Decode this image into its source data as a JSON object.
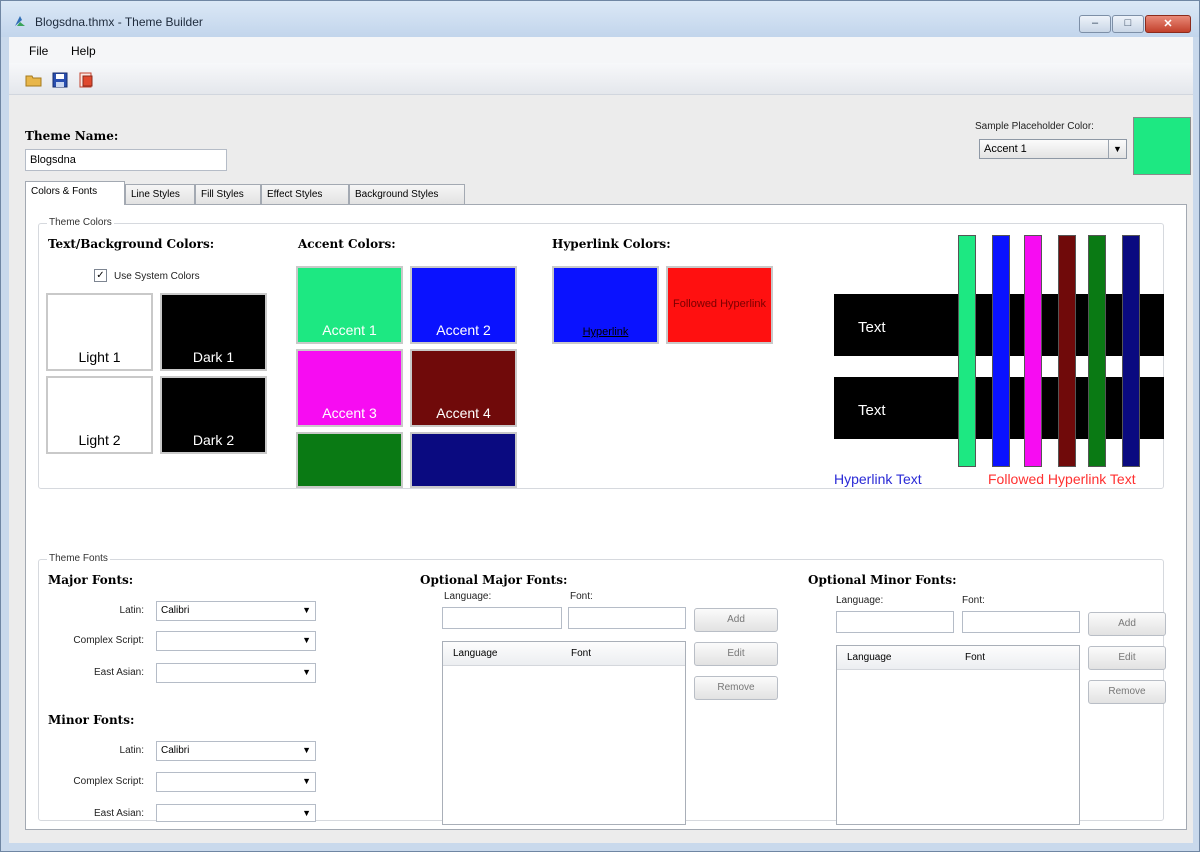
{
  "window": {
    "title": "Blogsdna.thmx - Theme Builder",
    "min": "–",
    "max": "□",
    "close": "✕"
  },
  "menu": [
    "File",
    "Help"
  ],
  "toolbar": {
    "icons": [
      "open-folder-icon",
      "save-icon",
      "export-icon"
    ]
  },
  "theme_name": {
    "label": "Theme Name:",
    "value": "Blogsdna"
  },
  "placeholder": {
    "label": "Sample Placeholder Color:",
    "selected": "Accent 1",
    "color": "#1de882"
  },
  "tabs": [
    "Colors & Fonts",
    "Line Styles",
    "Fill Styles",
    "Effect Styles",
    "Background Styles"
  ],
  "theme_colors": {
    "legend": "Theme Colors",
    "text_bg": {
      "heading": "Text/Background Colors:",
      "use_system": "Use System Colors",
      "swatches": [
        {
          "label": "Light 1",
          "color": "#ffffff",
          "text": "#000000"
        },
        {
          "label": "Dark 1",
          "color": "#000000",
          "text": "#ffffff"
        },
        {
          "label": "Light 2",
          "color": "#ffffff",
          "text": "#000000"
        },
        {
          "label": "Dark 2",
          "color": "#000000",
          "text": "#ffffff"
        }
      ]
    },
    "accent": {
      "heading": "Accent Colors:",
      "swatches": [
        {
          "label": "Accent 1",
          "color": "#1de882"
        },
        {
          "label": "Accent 2",
          "color": "#0a12ff"
        },
        {
          "label": "Accent 3",
          "color": "#f70cf2"
        },
        {
          "label": "Accent 4",
          "color": "#700a0a"
        },
        {
          "label": "",
          "color": "#0a7a14"
        },
        {
          "label": "",
          "color": "#0a0a80"
        }
      ]
    },
    "hyperlink": {
      "heading": "Hyperlink Colors:",
      "hyperlink_label": "Hyperlink",
      "hyperlink_color": "#0a12ff",
      "followed_label": "Followed Hyperlink",
      "followed_color": "#ff1010"
    },
    "preview": {
      "text1": "Text",
      "text2": "Text",
      "hyperlink_text": "Hyperlink Text",
      "followed_text": "Followed Hyperlink Text",
      "stripes": [
        "#1de882",
        "#0a12ff",
        "#f70cf2",
        "#700a0a",
        "#0a7a14",
        "#0a0a80"
      ]
    }
  },
  "theme_fonts": {
    "legend": "Theme Fonts",
    "major": {
      "heading": "Major Fonts:",
      "latin_label": "Latin:",
      "latin_value": "Calibri",
      "complex_label": "Complex Script:",
      "complex_value": "",
      "east_label": "East Asian:",
      "east_value": ""
    },
    "minor": {
      "heading": "Minor Fonts:",
      "latin_label": "Latin:",
      "latin_value": "Calibri",
      "complex_label": "Complex Script:",
      "complex_value": "",
      "east_label": "East Asian:",
      "east_value": ""
    },
    "optional_major": {
      "heading": "Optional Major Fonts:",
      "language_label": "Language:",
      "font_label": "Font:",
      "add": "Add",
      "edit": "Edit",
      "remove": "Remove",
      "col_language": "Language",
      "col_font": "Font"
    },
    "optional_minor": {
      "heading": "Optional Minor Fonts:",
      "language_label": "Language:",
      "font_label": "Font:",
      "add": "Add",
      "edit": "Edit",
      "remove": "Remove",
      "col_language": "Language",
      "col_font": "Font"
    }
  }
}
